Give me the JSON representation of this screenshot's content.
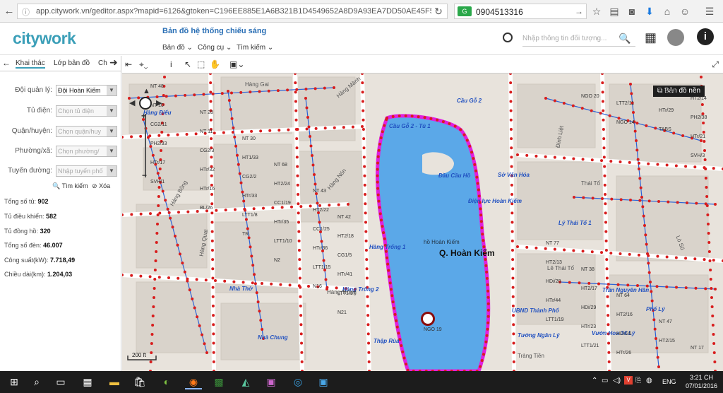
{
  "browser": {
    "url": "app.citywork.vn/geditor.aspx?mapid=6126&gtoken=C196EE885E1A6B321B1D4549652A8D9A93EA7DD50AE45F5F",
    "search_value": "0904513316"
  },
  "header": {
    "logo": "citywork",
    "title": "Bản đồ hệ thống chiếu sáng",
    "menu": [
      "Bản đồ",
      "Công cụ",
      "Tìm kiếm"
    ],
    "search_placeholder": "Nhập thông tin đối tượng..."
  },
  "sidebar": {
    "tabs": [
      "Khai thác",
      "Lớp bản đồ",
      "Ch"
    ],
    "fields": [
      {
        "label": "Đội quản lý:",
        "value": "Đội Hoàn Kiếm"
      },
      {
        "label": "Tủ điện:",
        "value": "Chọn tủ điện"
      },
      {
        "label": "Quận/huyện:",
        "value": "Chọn quận/huy"
      },
      {
        "label": "Phường/xã:",
        "value": "Chọn phường/"
      },
      {
        "label": "Tuyến đường:",
        "value": "Nhập tuyến phố"
      }
    ],
    "search_label": "Tìm kiếm",
    "clear_label": "Xóa",
    "stats": [
      {
        "label": "Tổng số tủ:",
        "value": "902"
      },
      {
        "label": "Tủ điều khiển:",
        "value": "582"
      },
      {
        "label": "Tủ đồng hồ:",
        "value": "320"
      },
      {
        "label": "Tổng số đèn:",
        "value": "46.007"
      },
      {
        "label": "Công suất(kW):",
        "value": "7.718,49"
      },
      {
        "label": "Chiều dài(km):",
        "value": "1.204,03"
      }
    ]
  },
  "map": {
    "basemap_label": "Bản đồ nền",
    "district_label": "Q. Hoàn Kiếm",
    "lake_label": "hồ Hoàn Kiếm",
    "scale_label": "200 ft",
    "places": [
      "Hàng Điếu",
      "Cầu Gỗ 2",
      "Cầu Gỗ 2 - Tủ 1",
      "Đầu Cầu Hồ",
      "Sở Văn Hóa",
      "Điện lực Hoàn Kiếm",
      "Hàng Trống 1",
      "Hàng Trống 2",
      "Nhà Thờ",
      "Lý Thái Tổ 1",
      "Trần Nguyên Hãn",
      "UBND Thành Phố",
      "Tường Ngân Lý",
      "Vườn Hoa 34 Lý",
      "Thập Rùa",
      "Nhà Chung",
      "Phố Lý"
    ],
    "streets": [
      "Hàng Gai",
      "Hàng Bông",
      "Hàng Trống",
      "Thái Tổ",
      "Lê Thái Tổ",
      "Hàng Mành",
      "Hàng Quạt",
      "Hàng Nón",
      "Đinh Liệt",
      "Lò Sũ",
      "Tràng Tiền"
    ],
    "nodes": [
      "NT 48",
      "NT 28",
      "NT 30",
      "NT 68",
      "NT 43",
      "NT 42",
      "NT 77",
      "NT 38",
      "NT 64",
      "NT 47",
      "NT 17",
      "NT 10",
      "NT 11",
      "HT1/33",
      "HT2/24",
      "HT2/22",
      "HT2/18",
      "HT2/13",
      "HT2/17",
      "HT2/16",
      "HT2/15",
      "HT2/14",
      "CG2/11",
      "CG2/3",
      "CG2/2",
      "CC1/19",
      "CC1/25",
      "CG1/5",
      "HDi/28",
      "HDi/29",
      "HDi/26",
      "PH1/37",
      "PH2/38",
      "PH2/33",
      "HTr/32",
      "HTr/33",
      "HTr/35",
      "HTr/36",
      "HTr/41",
      "HTr/44",
      "HTr/23",
      "HTr/26",
      "HTr/29",
      "HTr/21",
      "HTr/17",
      "HTr/16",
      "LTT1/8",
      "LTT1/10",
      "LTT1/15",
      "LTT1/17",
      "LTT1/19",
      "LTT1/21",
      "LTT2/11",
      "TABS",
      "SVH/3",
      "SVH/1",
      "BL/26",
      "TR.",
      "N2",
      "N16",
      "N21",
      "NGO 19",
      "NGO 20",
      "NGO 14"
    ]
  },
  "taskbar": {
    "lang": "ENG",
    "time": "3:21 CH",
    "date": "07/01/2016"
  },
  "colors": {
    "accent": "#3b9fb8",
    "lake": "#5ba8e8",
    "lake_border": "#e020e0",
    "light_dot": "#d81d1d",
    "cable": "#2b62d6"
  }
}
